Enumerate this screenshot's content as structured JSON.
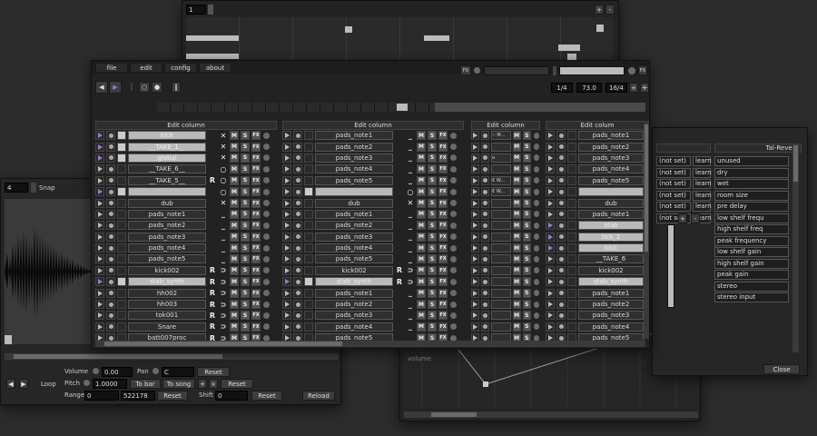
{
  "top_window": {
    "field_value": "1"
  },
  "menu": [
    "file",
    "edit",
    "config",
    "about"
  ],
  "titlebar": {
    "fx_label": "FX"
  },
  "transport": {
    "time_sig": "1/4",
    "bpm": "73.0",
    "quant": "16/4"
  },
  "columns": [
    {
      "header": "Edit column",
      "rows": [
        {
          "name": "kick",
          "icon": "x",
          "r": false,
          "hl": true,
          "purple": true
        },
        {
          "name": "__TAKE_1__",
          "icon": "x",
          "r": false,
          "hl": true,
          "purple": true
        },
        {
          "name": "global",
          "icon": "x",
          "r": false,
          "hl": true,
          "purple": true
        },
        {
          "name": "__TAKE_6__",
          "icon": "o",
          "r": false,
          "hl": false
        },
        {
          "name": "__TAKE_5__",
          "icon": "o",
          "r": true,
          "hl": false
        },
        {
          "name": "",
          "icon": "o",
          "r": false,
          "hl": true,
          "purple": true
        },
        {
          "name": "dub",
          "icon": "x",
          "r": false,
          "hl": false
        },
        {
          "name": "pads_note1",
          "icon": "_",
          "r": false,
          "hl": false
        },
        {
          "name": "pads_note2",
          "icon": "_",
          "r": false,
          "hl": false
        },
        {
          "name": "pads_note3",
          "icon": "_",
          "r": false,
          "hl": false
        },
        {
          "name": "pads_note4",
          "icon": "_",
          "r": false,
          "hl": false
        },
        {
          "name": "pads_note5",
          "icon": "_",
          "r": false,
          "hl": false
        },
        {
          "name": "kick002",
          "icon": "u",
          "r": true,
          "hl": false
        },
        {
          "name": "stab_synth",
          "icon": "u",
          "r": true,
          "hl": true,
          "purple": true
        },
        {
          "name": "hh002",
          "icon": "u",
          "r": true,
          "hl": false
        },
        {
          "name": "hh003",
          "icon": "u",
          "r": true,
          "hl": false
        },
        {
          "name": "tok001",
          "icon": "u",
          "r": true,
          "hl": false
        },
        {
          "name": "Snare",
          "icon": "u",
          "r": true,
          "hl": false
        },
        {
          "name": "batt007proc",
          "icon": "u",
          "r": true,
          "hl": false
        }
      ]
    },
    {
      "header": "Edit column",
      "rows": [
        {
          "name": "pads_note1",
          "icon": "_",
          "r": false,
          "hl": false
        },
        {
          "name": "pads_note2",
          "icon": "_",
          "r": false,
          "hl": false
        },
        {
          "name": "pads_note3",
          "icon": "_",
          "r": false,
          "hl": false
        },
        {
          "name": "pads_note4",
          "icon": "_",
          "r": false,
          "hl": false
        },
        {
          "name": "pads_note5",
          "icon": "_",
          "r": false,
          "hl": false
        },
        {
          "name": "",
          "icon": "o",
          "r": false,
          "hl": true
        },
        {
          "name": "dub",
          "icon": "x",
          "r": false,
          "hl": false
        },
        {
          "name": "pads_note1",
          "icon": "_",
          "r": false,
          "hl": false
        },
        {
          "name": "pads_note2",
          "icon": "_",
          "r": false,
          "hl": false
        },
        {
          "name": "pads_note3",
          "icon": "_",
          "r": false,
          "hl": false
        },
        {
          "name": "pads_note4",
          "icon": "_",
          "r": false,
          "hl": false
        },
        {
          "name": "pads_note5",
          "icon": "_",
          "r": false,
          "hl": false
        },
        {
          "name": "kick002",
          "icon": "u",
          "r": true,
          "hl": false
        },
        {
          "name": "stab_synth",
          "icon": "u",
          "r": true,
          "hl": true,
          "purple": true
        },
        {
          "name": "pads_note1",
          "icon": "_",
          "r": false,
          "hl": false
        },
        {
          "name": "pads_note2",
          "icon": "_",
          "r": false,
          "hl": false
        },
        {
          "name": "pads_note3",
          "icon": "_",
          "r": false,
          "hl": false
        },
        {
          "name": "pads_note4",
          "icon": "_",
          "r": false,
          "hl": false
        },
        {
          "name": "pads_note5",
          "icon": "_",
          "r": false,
          "hl": false
        }
      ]
    },
    {
      "header": "Edit column",
      "rows": [
        {
          "name": "-- M..."
        },
        {
          "name": ""
        },
        {
          "name": "o"
        },
        {
          "name": ""
        },
        {
          "name": "€ W..."
        },
        {
          "name": "€ W..."
        },
        {
          "name": ""
        },
        {
          "name": ""
        },
        {
          "name": ""
        },
        {
          "name": ""
        },
        {
          "name": ""
        },
        {
          "name": ""
        },
        {
          "name": ""
        },
        {
          "name": ""
        },
        {
          "name": ""
        },
        {
          "name": ""
        },
        {
          "name": ""
        },
        {
          "name": ""
        },
        {
          "name": ""
        }
      ]
    },
    {
      "header": "Edit colum",
      "rows": [
        {
          "name": "pads_note1"
        },
        {
          "name": "pads_note2"
        },
        {
          "name": "pads_note3"
        },
        {
          "name": "pads_note4"
        },
        {
          "name": "pads_note5"
        },
        {
          "name": ""
        },
        {
          "name": "dub"
        },
        {
          "name": "pads_note1"
        },
        {
          "name": "stab"
        },
        {
          "name": "tick_1"
        },
        {
          "name": "kick"
        },
        {
          "name": "__TAKE_6"
        },
        {
          "name": "kick002"
        },
        {
          "name": "stab_synth"
        },
        {
          "name": "pads_note1"
        },
        {
          "name": "pads_note2"
        },
        {
          "name": "pads_note3"
        },
        {
          "name": "pads_note4"
        },
        {
          "name": "pads_note5"
        }
      ]
    }
  ],
  "plugin_window": {
    "title": "Tal-Reverb",
    "midi_rows": [
      "(not set)",
      "(not set)",
      "(not set)",
      "(not set)",
      "(not set)",
      "(not set)"
    ],
    "learn_label": "learn",
    "params": [
      "unused",
      "dry",
      "wet",
      "room size",
      "pre delay",
      "low shelf frequ",
      "high shelf freq",
      "peak frequency",
      "low shelf gain",
      "high shelf gain",
      "peak gain",
      "stereo",
      "stereo input"
    ],
    "close_label": "Close"
  },
  "automation": {
    "label": "volume"
  },
  "sample_editor": {
    "num_field": "4",
    "snap_label": "Snap",
    "loop_label": "Loop",
    "volume_label": "Volume",
    "volume_value": "0.00",
    "pan_label": "Pan",
    "pan_value": "C",
    "reset_label": "Reset",
    "pitch_label": "Pitch",
    "pitch_value": "1.0000",
    "to_bar_label": "To bar",
    "to_song_label": "To song",
    "range_label": "Range",
    "range_start": "0",
    "range_end": "522178",
    "shift_label": "Shift",
    "shift_value": "0",
    "reload_label": "Reload"
  }
}
